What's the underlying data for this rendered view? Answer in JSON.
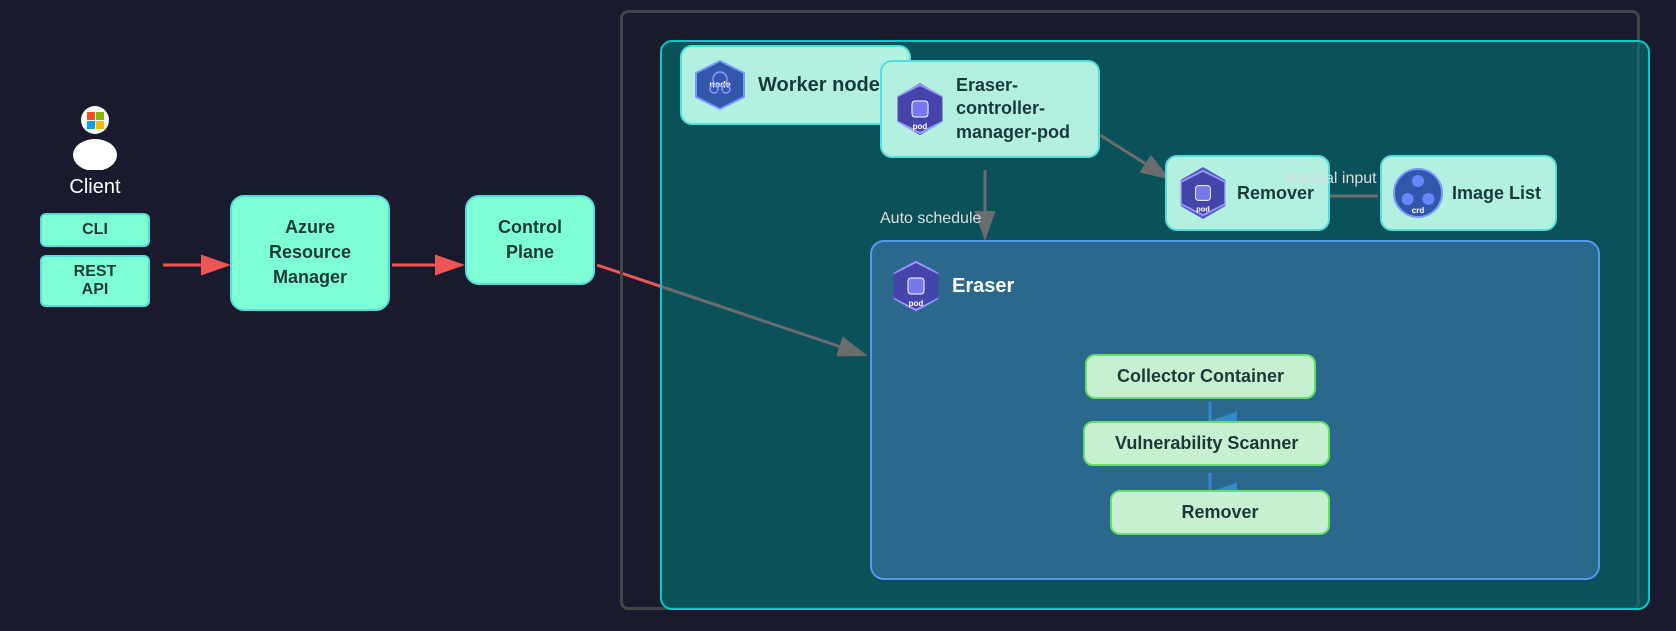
{
  "client": {
    "label": "Client",
    "sub_boxes": [
      "CLI",
      "REST API"
    ]
  },
  "azure_resource_manager": {
    "label": "Azure Resource Manager"
  },
  "control_plane": {
    "label": "Control Plane"
  },
  "worker_nodes": {
    "label": "Worker nodes"
  },
  "eraser_controller": {
    "label": "Eraser-controller-manager-pod"
  },
  "remover_pod": {
    "label": "Remover"
  },
  "image_list": {
    "label": "Image List"
  },
  "eraser_pod": {
    "label": "Eraser"
  },
  "containers": {
    "collector": "Collector Container",
    "scanner": "Vulnerability Scanner",
    "remover": "Remover"
  },
  "labels": {
    "auto_schedule": "Auto schedule",
    "manual_input": "Manual input"
  },
  "icons": {
    "pod": "pod",
    "node": "node",
    "crd": "crd"
  }
}
